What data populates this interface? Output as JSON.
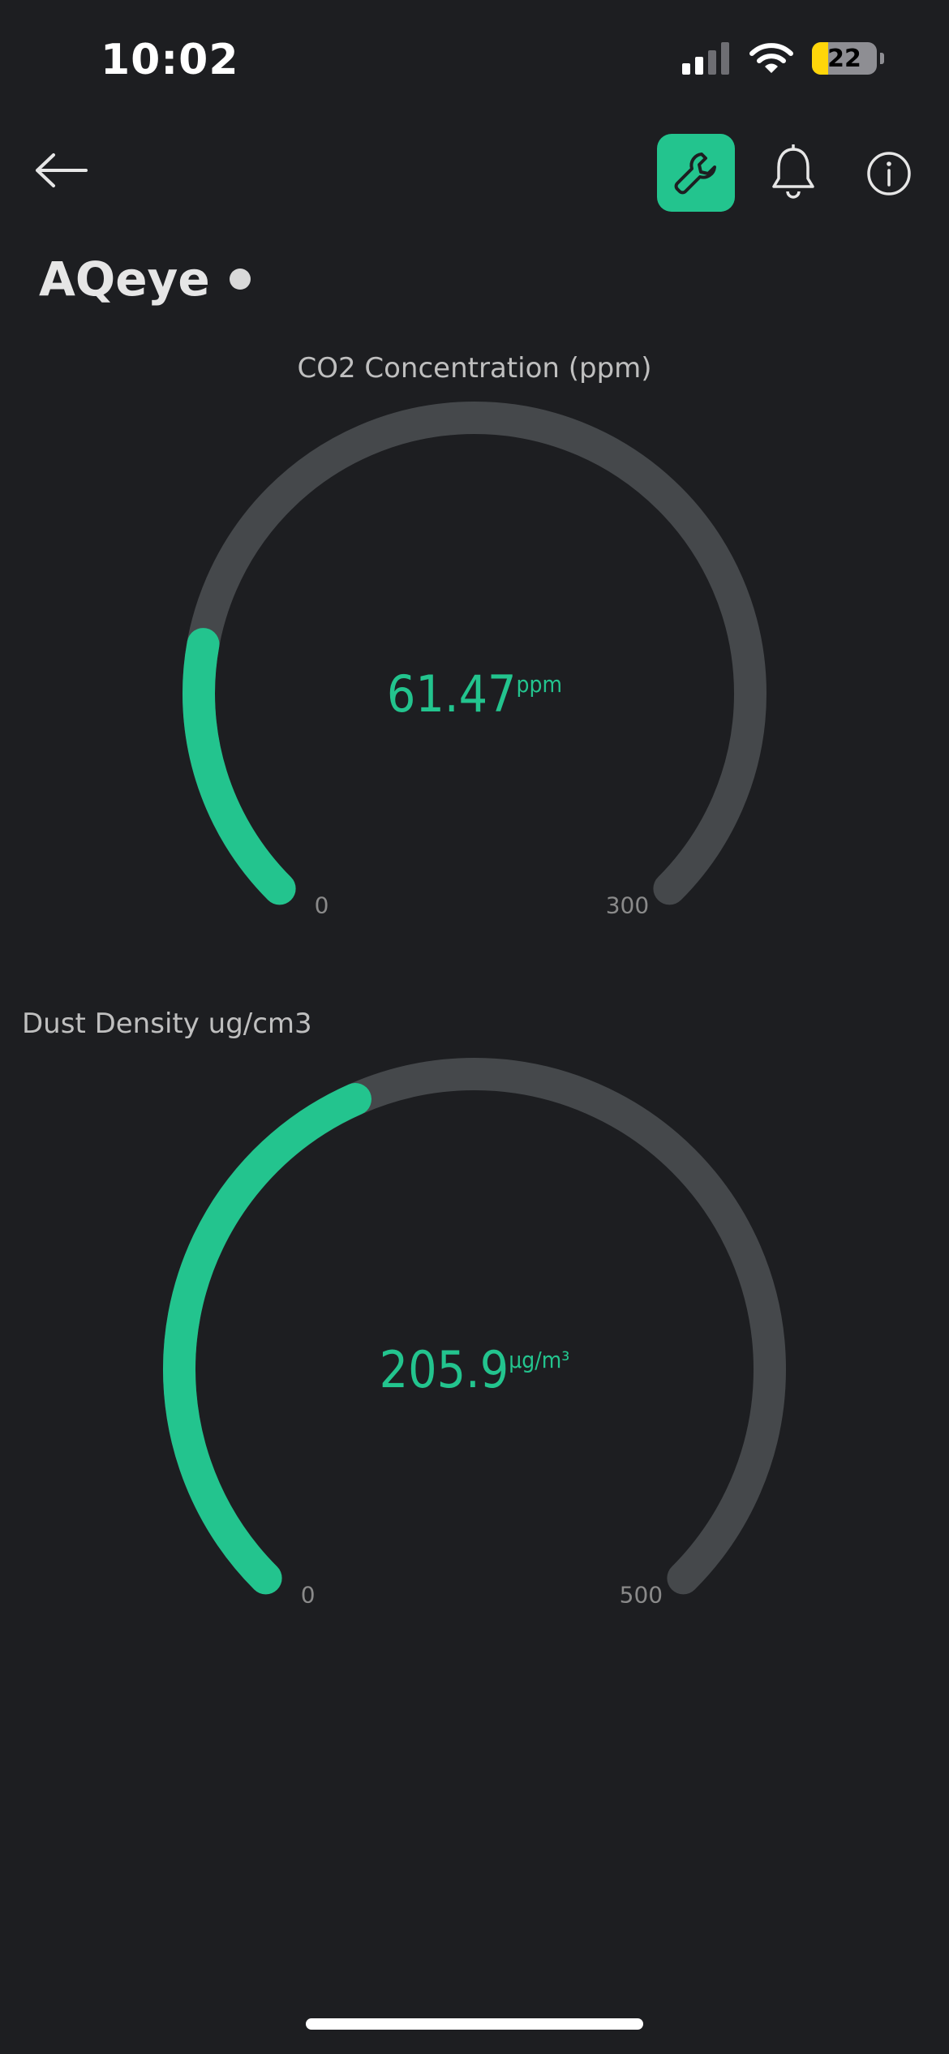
{
  "status_bar": {
    "time": "10:02",
    "battery_level": "22",
    "icons": [
      "signal-icon",
      "wifi-icon",
      "battery-icon"
    ]
  },
  "header": {
    "back_icon": "arrow-left-icon",
    "actions": [
      "wrench-icon",
      "bell-icon",
      "info-icon"
    ]
  },
  "device": {
    "name": "AQeye",
    "status": "online"
  },
  "colors": {
    "background": "#1d1e21",
    "accent": "#23c48e",
    "track": "#45484b",
    "label": "#bfbfbf"
  },
  "gauges": [
    {
      "title": "CO2 Concentration (ppm)",
      "value": 61.47,
      "value_text": "61.47",
      "unit": "ppm",
      "min": 0,
      "max": 300,
      "min_label": "0",
      "max_label": "300"
    },
    {
      "title": "Dust Density ug/cm3",
      "value": 205.9,
      "value_text": "205.9",
      "unit": "µg/m³",
      "min": 0,
      "max": 500,
      "min_label": "0",
      "max_label": "500"
    }
  ]
}
